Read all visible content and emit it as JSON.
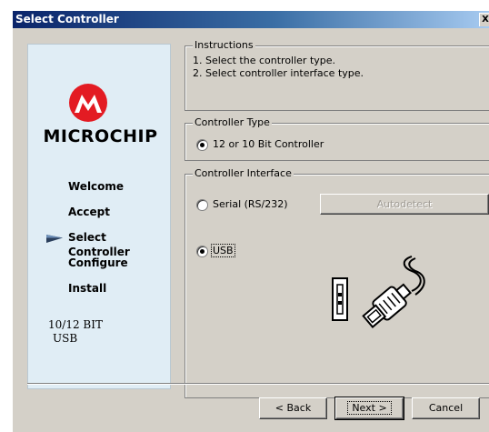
{
  "window": {
    "title": "Select Controller",
    "close_label": "X"
  },
  "sidebar": {
    "brand": "MICROCHIP",
    "steps": [
      {
        "label": "Welcome",
        "current": false
      },
      {
        "label": "Accept",
        "current": false
      },
      {
        "label": "Select Controller",
        "current": true
      },
      {
        "label": "Configure",
        "current": false
      },
      {
        "label": "Install",
        "current": false
      }
    ],
    "version_line1": "10/12 BIT",
    "version_line2": "USB"
  },
  "instructions": {
    "legend": "Instructions",
    "line1": "1. Select the controller type.",
    "line2": "2. Select controller interface type."
  },
  "controller_type": {
    "legend": "Controller Type",
    "option": "12 or 10 Bit Controller",
    "selected": true
  },
  "controller_interface": {
    "legend": "Controller Interface",
    "serial_label": "Serial (RS/232)",
    "serial_selected": false,
    "autodetect_label": "Autodetect",
    "usb_label": "USB",
    "usb_selected": true
  },
  "footer": {
    "back_label": "< Back",
    "next_label": "Next >",
    "cancel_label": "Cancel"
  },
  "colors": {
    "title_gradient_start": "#0a246a",
    "dialog_face": "#d4d0c8",
    "sidebar_bg": "#e0edf5",
    "logo_red": "#e31b23"
  }
}
